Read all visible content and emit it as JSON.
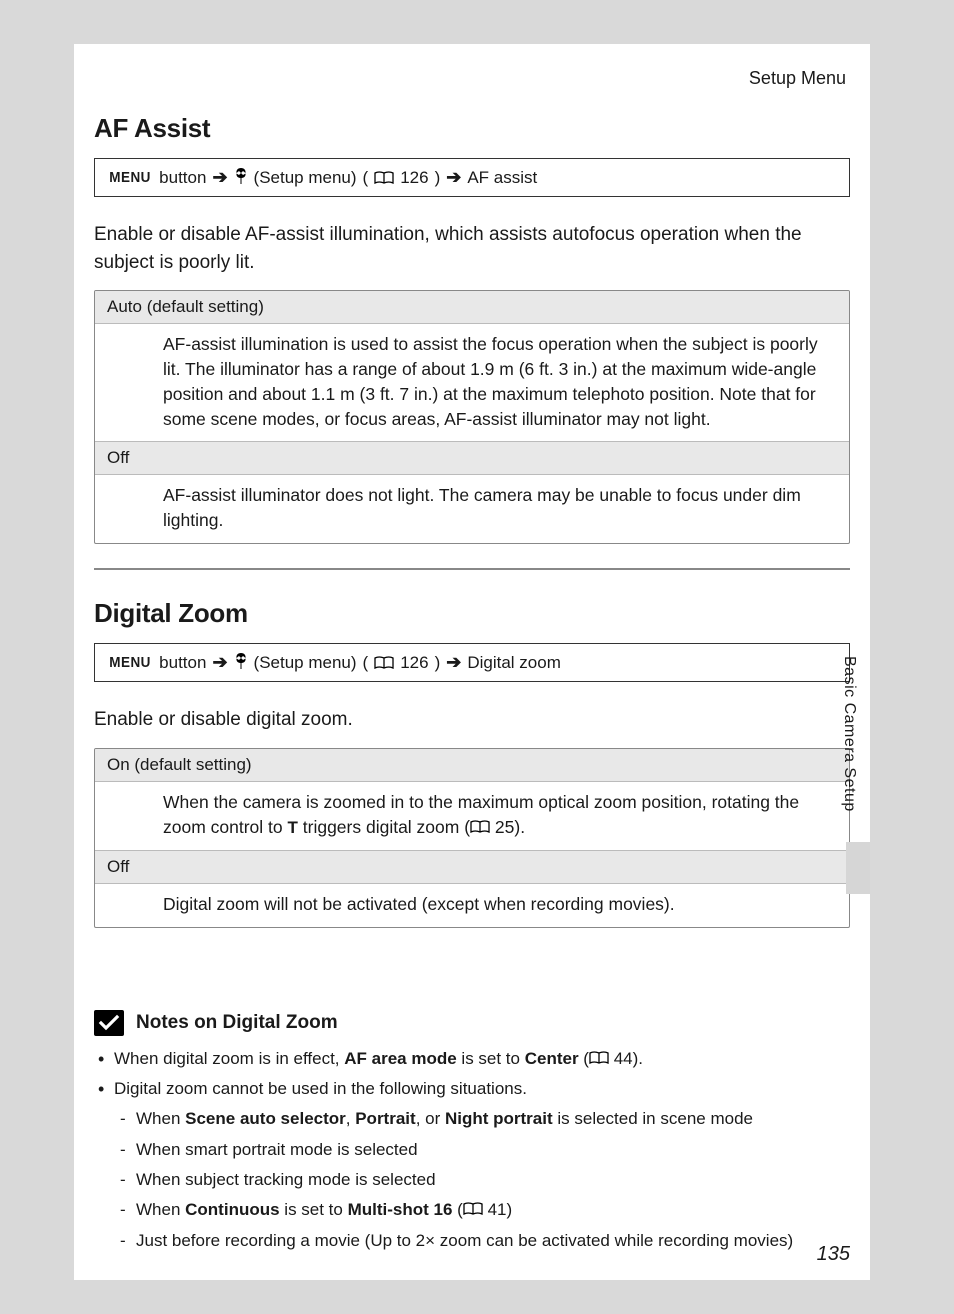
{
  "header": {
    "section_label": "Setup Menu"
  },
  "side": {
    "label": "Basic Camera Setup"
  },
  "page_number": "135",
  "breadcrumb_tokens": {
    "menu": "MENU",
    "button": "button",
    "setup": "(Setup menu)"
  },
  "sections": {
    "af_assist": {
      "title": "AF Assist",
      "crumb_ref": "126",
      "crumb_tail": "AF assist",
      "intro": "Enable or disable AF-assist illumination, which assists autofocus operation when the subject is poorly lit.",
      "options": [
        {
          "label": "Auto (default setting)",
          "body": "AF-assist illumination is used to assist the focus operation when the subject is poorly lit. The illuminator has a range of about 1.9 m (6 ft. 3 in.) at the maximum wide-angle position and about 1.1 m (3 ft. 7 in.) at the maximum telephoto position. Note that for some scene modes, or focus areas, AF-assist illuminator may not light."
        },
        {
          "label": "Off",
          "body": "AF-assist illuminator does not light. The camera may be unable to focus under dim lighting."
        }
      ]
    },
    "digital_zoom": {
      "title": "Digital Zoom",
      "crumb_ref": "126",
      "crumb_tail": "Digital zoom",
      "intro": "Enable or disable digital zoom.",
      "options": [
        {
          "label": "On (default setting)",
          "body_pre": "When the camera is zoomed in to the maximum optical zoom position, rotating the zoom control to ",
          "t": "T",
          "body_mid": " triggers digital zoom (",
          "ref": "25",
          "body_post": ")."
        },
        {
          "label": "Off",
          "body": "Digital zoom will not be activated (except when recording movies)."
        }
      ]
    }
  },
  "notes": {
    "heading": "Notes on Digital Zoom",
    "bullet1": {
      "pre": "When digital zoom is in effect, ",
      "b1": "AF area mode",
      "mid": " is set to ",
      "b2": "Center",
      "paren_open": " (",
      "ref": "44",
      "paren_close": ")."
    },
    "bullet2": {
      "lead": "Digital zoom cannot be used in the following situations.",
      "sub": [
        {
          "pre": "When ",
          "b1": "Scene auto selector",
          "mid1": ", ",
          "b2": "Portrait",
          "mid2": ", or ",
          "b3": "Night portrait",
          "post": " is selected in scene mode"
        },
        {
          "text": "When smart portrait mode is selected"
        },
        {
          "text": "When subject tracking mode is selected"
        },
        {
          "pre": "When ",
          "b1": "Continuous",
          "mid1": " is set to ",
          "b2": "Multi-shot 16",
          "paren_open": " (",
          "ref": "41",
          "paren_close": ")"
        },
        {
          "text": "Just before recording a movie (Up to 2× zoom can be activated while recording movies)"
        }
      ]
    }
  }
}
